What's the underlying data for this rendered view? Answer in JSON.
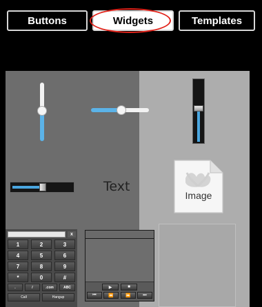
{
  "tabs": [
    {
      "label": "Buttons",
      "active": false
    },
    {
      "label": "Widgets",
      "active": true
    },
    {
      "label": "Templates",
      "active": false
    }
  ],
  "colors": {
    "accent_blue": "#5bb3e8",
    "highlight_red": "#e2231a",
    "panel_dark": "#6d6d6d",
    "panel_light": "#adadad"
  },
  "widgets": {
    "vertical_slider_level": 0.45,
    "horizontal_slider_level": 0.52,
    "vertical_fader_level": 0.5,
    "horizontal_fader_level": 0.47,
    "text_label": "Text",
    "image_label": "Image"
  },
  "keypad": {
    "clear_label": "x",
    "rows": [
      [
        "1",
        "2",
        "3"
      ],
      [
        "4",
        "5",
        "6"
      ],
      [
        "7",
        "8",
        "9"
      ],
      [
        "*",
        "0",
        "#"
      ],
      [
        ".",
        "/",
        ".com",
        "ABC"
      ]
    ],
    "call_label": "Call",
    "hangup_label": "Hangup"
  },
  "player": {
    "play_icon": "play-icon",
    "stop_icon": "stop-icon",
    "prev_icon": "skip-back-icon",
    "rewind_icon": "rewind-icon",
    "forward_icon": "fast-forward-icon",
    "next_icon": "skip-forward-icon"
  }
}
